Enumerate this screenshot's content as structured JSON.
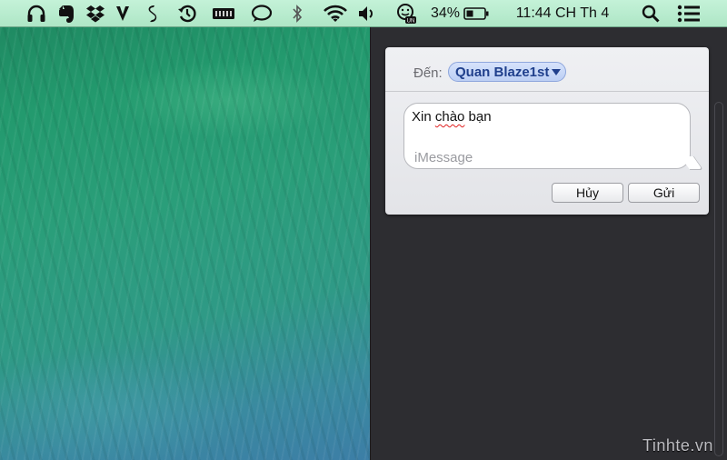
{
  "menubar": {
    "icons": [
      "headphones-icon",
      "evernote-icon",
      "dropbox-icon",
      "vlc-icon",
      "shazam-icon",
      "time-machine-icon",
      "battery-status-icon",
      "chat-icon",
      "bluetooth-icon",
      "wifi-icon",
      "volume-icon",
      "unikey-icon"
    ],
    "battery_percent": "34%",
    "clock": "11:44 CH Th 4"
  },
  "share_panel": {
    "to_label": "Đến:",
    "recipient": "Quan Blaze1st",
    "message_text": "Xin chào bạn",
    "message_misspelled": "chào",
    "message_rest_prefix": "Xin ",
    "message_rest_suffix": " bạn",
    "placeholder": "iMessage",
    "cancel_label": "Hủy",
    "send_label": "Gửi"
  },
  "watermark": "Tinhte.vn",
  "colors": {
    "menubar": "#b4e9cc",
    "recipient_chip": "#c8d8f8",
    "wallpaper": "#259a72"
  }
}
